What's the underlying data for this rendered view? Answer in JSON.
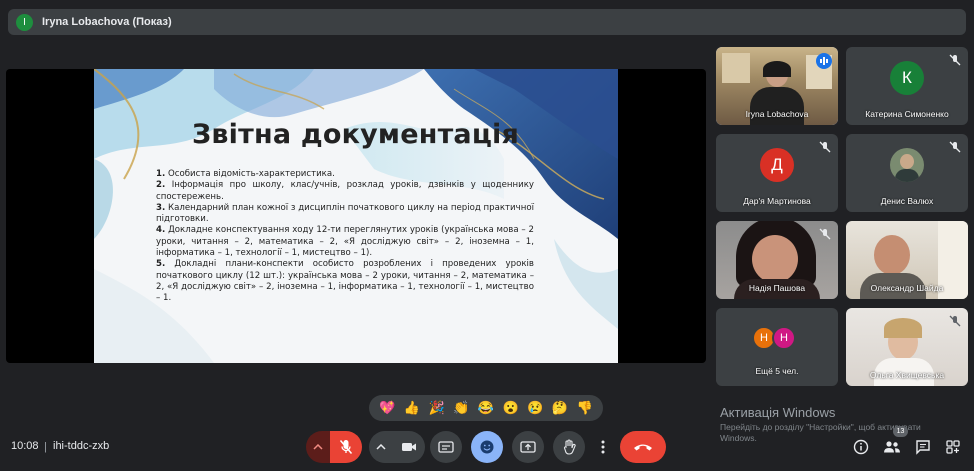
{
  "presenter": {
    "avatar_letter": "I",
    "title": "Iryna Lobachova (Показ)"
  },
  "slide": {
    "title": "Звітна документація",
    "items": [
      {
        "num": "1.",
        "text": " Особиста відомість-характеристика."
      },
      {
        "num": "2.",
        "text": " Інформація про школу, клас/учнів, розклад уроків, дзвінків у щоденнику спостережень."
      },
      {
        "num": "3.",
        "text": " Календарний план кожної з дисциплін початкового циклу на період практичної підготовки."
      },
      {
        "num": "4.",
        "text": " Докладне конспектування ходу 12-ти переглянутих уроків (українська мова – 2 уроки, читання – 2, математика – 2, «Я досліджую світ» – 2, іноземна – 1, інформатика – 1, технології – 1, мистецтво – 1)."
      },
      {
        "num": "5.",
        "text": " Докладні плани-конспекти особисто розроблених і проведених уроків початкового циклу (12 шт.): українська мова – 2 уроки, читання – 2, математика – 2, «Я досліджую світ» – 2, іноземна – 1, інформатика – 1, технології – 1, мистецтво – 1."
      }
    ]
  },
  "participants": [
    {
      "name": "Iryna Lobachova",
      "type": "video",
      "speaking": true
    },
    {
      "name": "Катерина Симоненко",
      "type": "avatar",
      "letter": "К",
      "color": "#188038"
    },
    {
      "name": "Дар'я Мартинова",
      "type": "avatar",
      "letter": "Д",
      "color": "#d93025"
    },
    {
      "name": "Денис Валюх",
      "type": "photo"
    },
    {
      "name": "Надія Пашова",
      "type": "video"
    },
    {
      "name": "Олександр Шайда",
      "type": "video"
    },
    {
      "name": "Ещё 5 чел.",
      "type": "more",
      "letters": [
        "Н",
        "Н"
      ]
    },
    {
      "name": "Ольга Хвищевська",
      "type": "video"
    }
  ],
  "reactions": [
    "💖",
    "👍",
    "🎉",
    "👏",
    "😂",
    "😮",
    "😢",
    "🤔",
    "👎"
  ],
  "watermark": {
    "title": "Активація Windows",
    "subtitle": "Перейдіть до розділу \"Настройки\", щоб активувати Windows."
  },
  "meeting": {
    "time": "10:08",
    "separator": "|",
    "code": "ihi-tddc-zxb",
    "people_count": "13"
  },
  "colors": {
    "end_call": "#ea4335",
    "mic_off": "#ea4335",
    "active_control": "#8ab4f8",
    "speaking": "#1a73e8"
  }
}
